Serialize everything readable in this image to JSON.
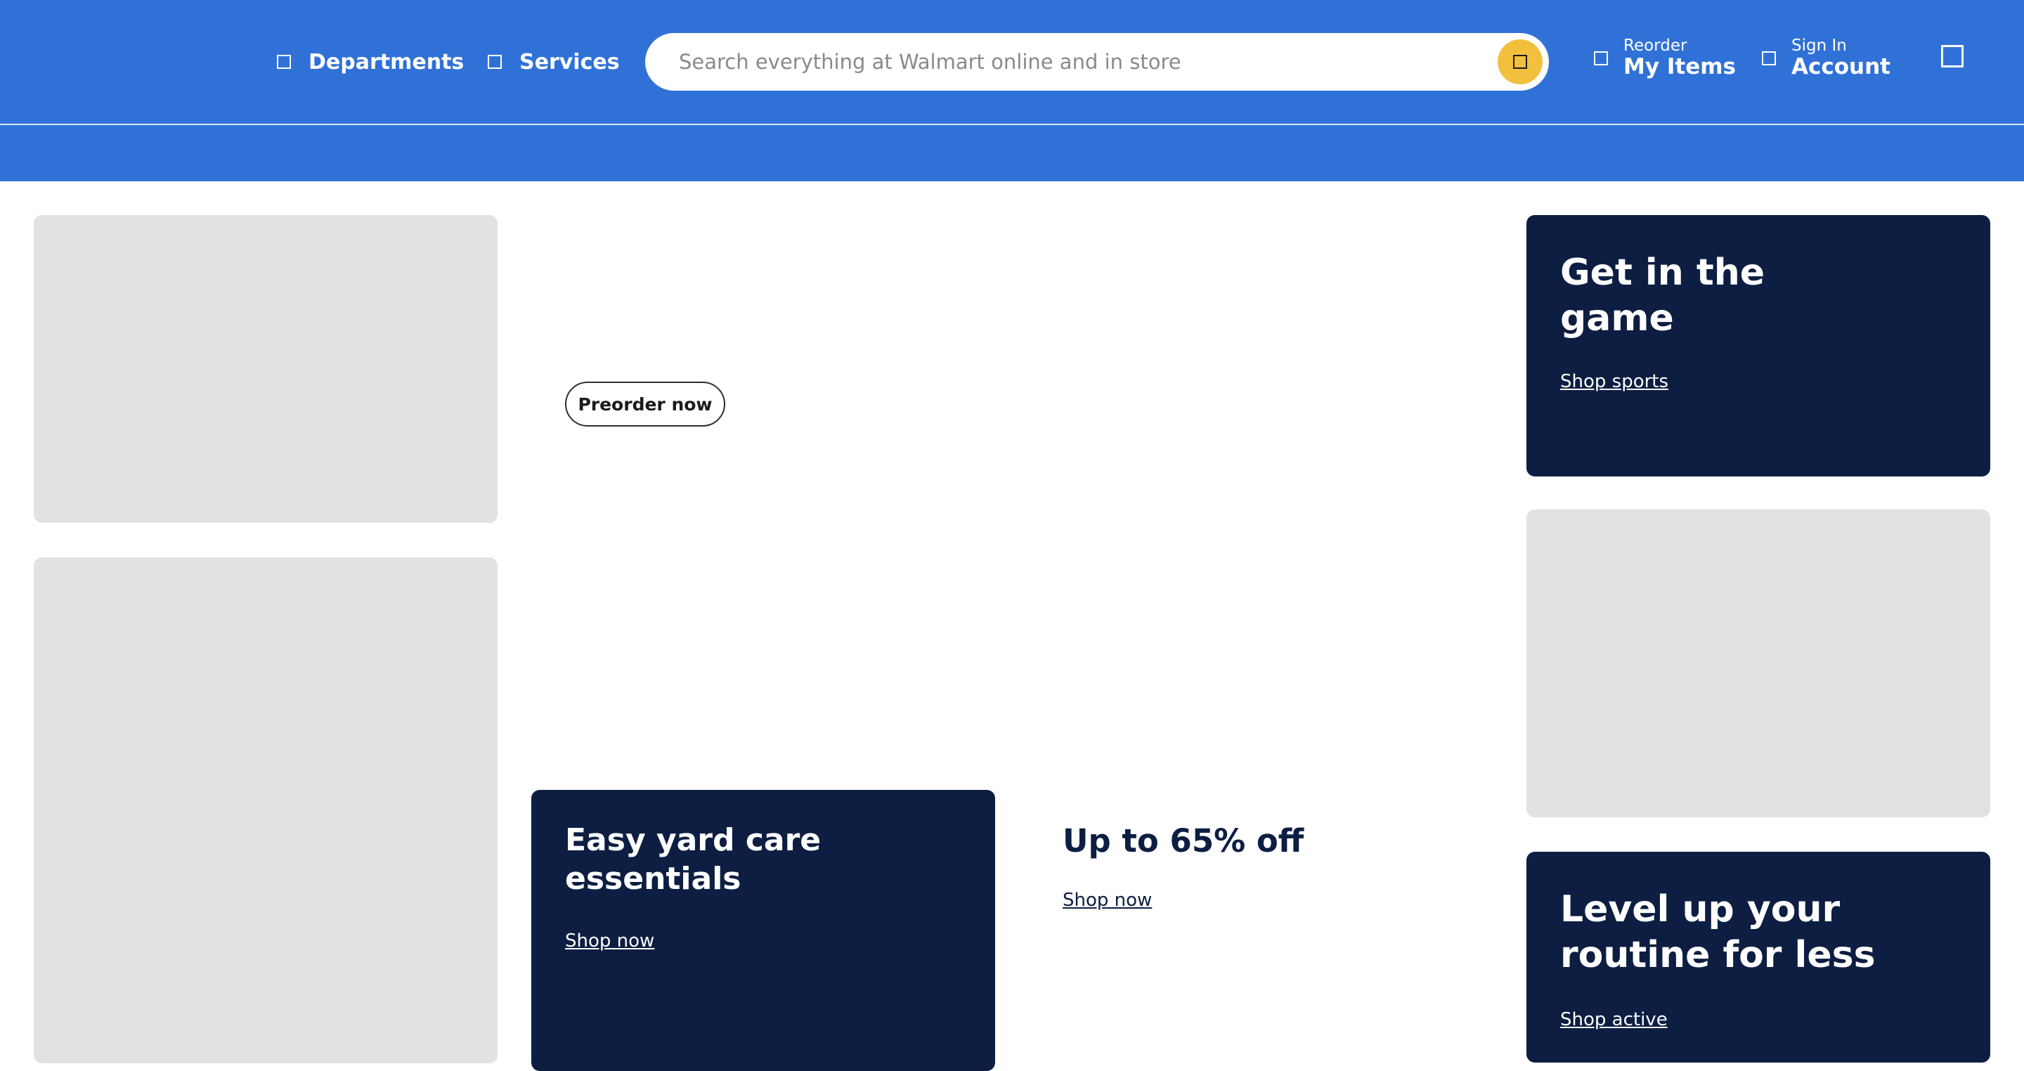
{
  "header": {
    "departments_label": "Departments",
    "services_label": "Services",
    "search_placeholder": "Search everything at Walmart online and in store",
    "reorder_small": "Reorder",
    "reorder_big": "My Items",
    "signin_small": "Sign In",
    "signin_big": "Account"
  },
  "hero": {
    "preorder_label": "Preorder now"
  },
  "promos": {
    "sports": {
      "title": "Get in the game",
      "link": "Shop sports"
    },
    "yard": {
      "title": "Easy yard care essentials",
      "link": "Shop now"
    },
    "sale": {
      "title": "Up to 65% off",
      "link": "Shop now"
    },
    "active": {
      "title": "Level up your routine for less",
      "link": "Shop active"
    }
  },
  "colors": {
    "header_blue": "#3071d7",
    "navy": "#0d1e42",
    "search_yellow": "#f3c03e",
    "placeholder_gray": "#e1e2e4"
  },
  "icons": {
    "departments": "grid-icon",
    "services": "services-icon",
    "search": "search-icon",
    "reorder": "reorder-icon",
    "account": "user-icon",
    "cart": "cart-icon"
  }
}
